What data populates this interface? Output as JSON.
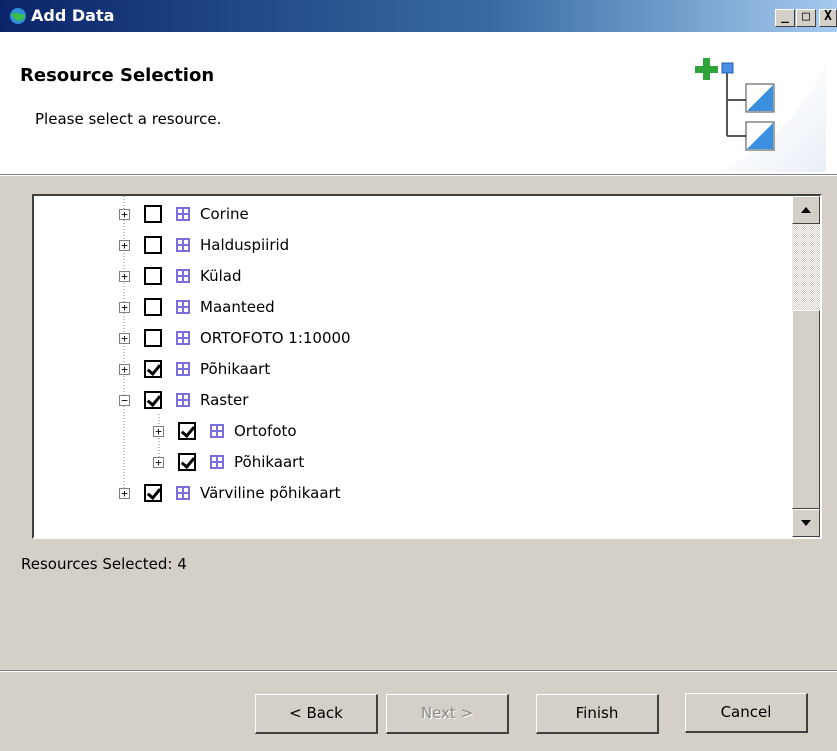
{
  "window": {
    "title": "Add Data"
  },
  "header": {
    "title": "Resource Selection",
    "description": "Please select a resource.",
    "icon": "add-data-tree-icon"
  },
  "title_buttons": {
    "minimize": "_",
    "maximize": "□",
    "close": "X"
  },
  "tree": {
    "items": [
      {
        "label": "Corine",
        "checked": false,
        "expander": "+",
        "level": 0
      },
      {
        "label": "Halduspiirid",
        "checked": false,
        "expander": "+",
        "level": 0
      },
      {
        "label": "Külad",
        "checked": false,
        "expander": "+",
        "level": 0
      },
      {
        "label": "Maanteed",
        "checked": false,
        "expander": "+",
        "level": 0
      },
      {
        "label": "ORTOFOTO 1:10000",
        "checked": false,
        "expander": "+",
        "level": 0
      },
      {
        "label": "Põhikaart",
        "checked": true,
        "expander": "+",
        "level": 0
      },
      {
        "label": "Raster",
        "checked": true,
        "expander": "−",
        "level": 0
      },
      {
        "label": "Ortofoto",
        "checked": true,
        "expander": "+",
        "level": 1
      },
      {
        "label": "Põhikaart",
        "checked": true,
        "expander": "+",
        "level": 1
      },
      {
        "label": "Värviline põhikaart",
        "checked": true,
        "expander": "+",
        "level": 0
      }
    ]
  },
  "status": {
    "text": "Resources Selected: 4"
  },
  "buttons": {
    "back": "< Back",
    "next": "Next >",
    "finish": "Finish",
    "cancel": "Cancel"
  }
}
